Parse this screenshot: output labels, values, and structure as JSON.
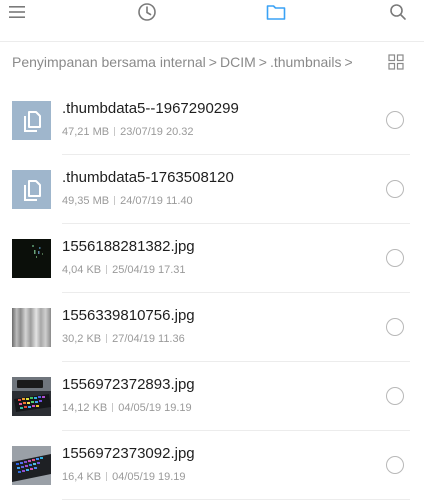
{
  "toolbar": {
    "icons": [
      "menu-icon",
      "recent-clock-icon",
      "folder-icon",
      "search-icon"
    ],
    "active_color": "#3aa2f5",
    "inactive_color": "#7a7a7a"
  },
  "breadcrumb": {
    "items": [
      "Penyimpanan bersama internal",
      "DCIM",
      ".thumbnails"
    ],
    "separator": ">"
  },
  "files": [
    {
      "name": ".thumbdata5--1967290299",
      "size": "47,21 MB",
      "date": "23/07/19 20.32",
      "thumb": "document-icon"
    },
    {
      "name": ".thumbdata5-1763508120",
      "size": "49,35 MB",
      "date": "24/07/19 11.40",
      "thumb": "document-icon"
    },
    {
      "name": "1556188281382.jpg",
      "size": "4,04 KB",
      "date": "25/04/19 17.31",
      "thumb": "dark-image-thumbnail"
    },
    {
      "name": "1556339810756.jpg",
      "size": "30,2 KB",
      "date": "27/04/19 11.36",
      "thumb": "grey-image-thumbnail"
    },
    {
      "name": "1556972372893.jpg",
      "size": "14,12 KB",
      "date": "04/05/19 19.19",
      "thumb": "keyboard-image-thumbnail"
    },
    {
      "name": "1556972373092.jpg",
      "size": "16,4 KB",
      "date": "04/05/19 19.19",
      "thumb": "keyboard-image-thumbnail"
    }
  ]
}
